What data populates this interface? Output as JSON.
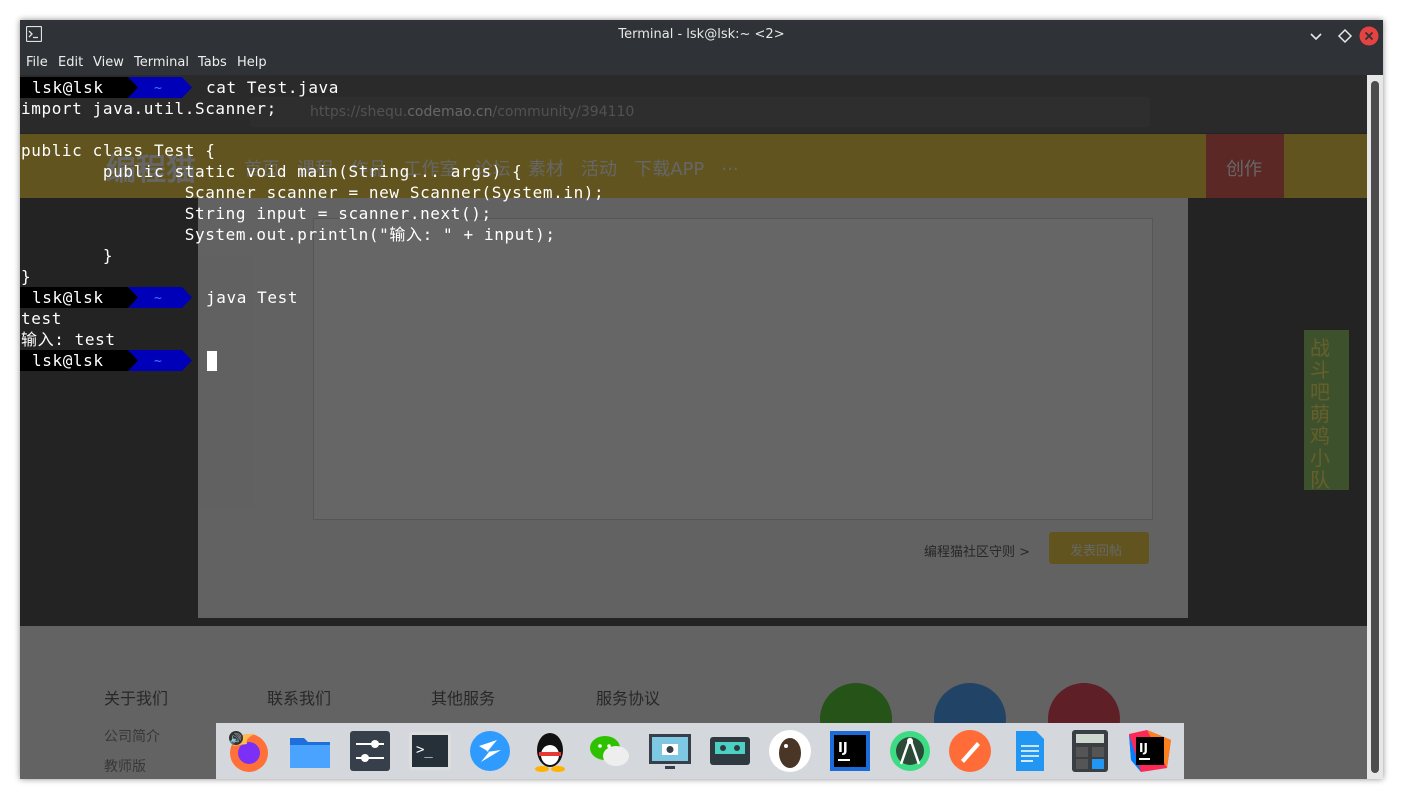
{
  "window": {
    "title": "Terminal - lsk@lsk:~ <2>"
  },
  "menubar": [
    "File",
    "Edit",
    "View",
    "Terminal",
    "Tabs",
    "Help"
  ],
  "background_page": {
    "url_prefix": "https://shequ.",
    "url_domain": "codemao.cn",
    "url_path": "/community/394110",
    "logo": "编程猫",
    "nav": [
      "首页",
      "课程",
      "作品",
      "工作室",
      "论坛",
      "素材",
      "活动",
      "下载APP",
      "···"
    ],
    "create_button": "创作",
    "guidelines_link": "编程猫社区守则 >",
    "submit_button": "发表回帖",
    "footer_columns": [
      "关于我们",
      "联系我们",
      "其他服务",
      "服务协议"
    ],
    "footer_links": [
      "公司简介",
      "教师版"
    ],
    "banner_text": "战斗吧萌鸡小队"
  },
  "terminal": {
    "prompt_user": "lsk@lsk",
    "prompt_dir": "~",
    "cmd1": "cat Test.java",
    "code": [
      "import java.util.Scanner;",
      "",
      "public class Test {",
      "        public static void main(String... args) {",
      "                Scanner scanner = new Scanner(System.in);",
      "                String input = scanner.next();",
      "                System.out.println(\"输入: \" + input);",
      "",
      "        }",
      "}"
    ],
    "cmd2": "java Test",
    "output": [
      "test",
      "输入: test"
    ]
  },
  "colors": {
    "prompt_user_bg": "#000000",
    "prompt_dir_bg": "#0000b8",
    "titlebar_bg": "#2f3236",
    "close_button": "#e54242",
    "terminal_text": "#ffffff"
  },
  "dock": [
    {
      "name": "firefox-icon"
    },
    {
      "name": "file-manager-icon"
    },
    {
      "name": "settings-icon"
    },
    {
      "name": "terminal-icon"
    },
    {
      "name": "thunder-icon"
    },
    {
      "name": "qq-icon"
    },
    {
      "name": "wechat-icon"
    },
    {
      "name": "screenshot-icon"
    },
    {
      "name": "cassette-icon"
    },
    {
      "name": "dbeaver-icon"
    },
    {
      "name": "intellij-icon"
    },
    {
      "name": "android-studio-icon"
    },
    {
      "name": "postman-icon"
    },
    {
      "name": "text-editor-icon"
    },
    {
      "name": "calculator-icon"
    },
    {
      "name": "intellij-ultimate-icon"
    }
  ]
}
